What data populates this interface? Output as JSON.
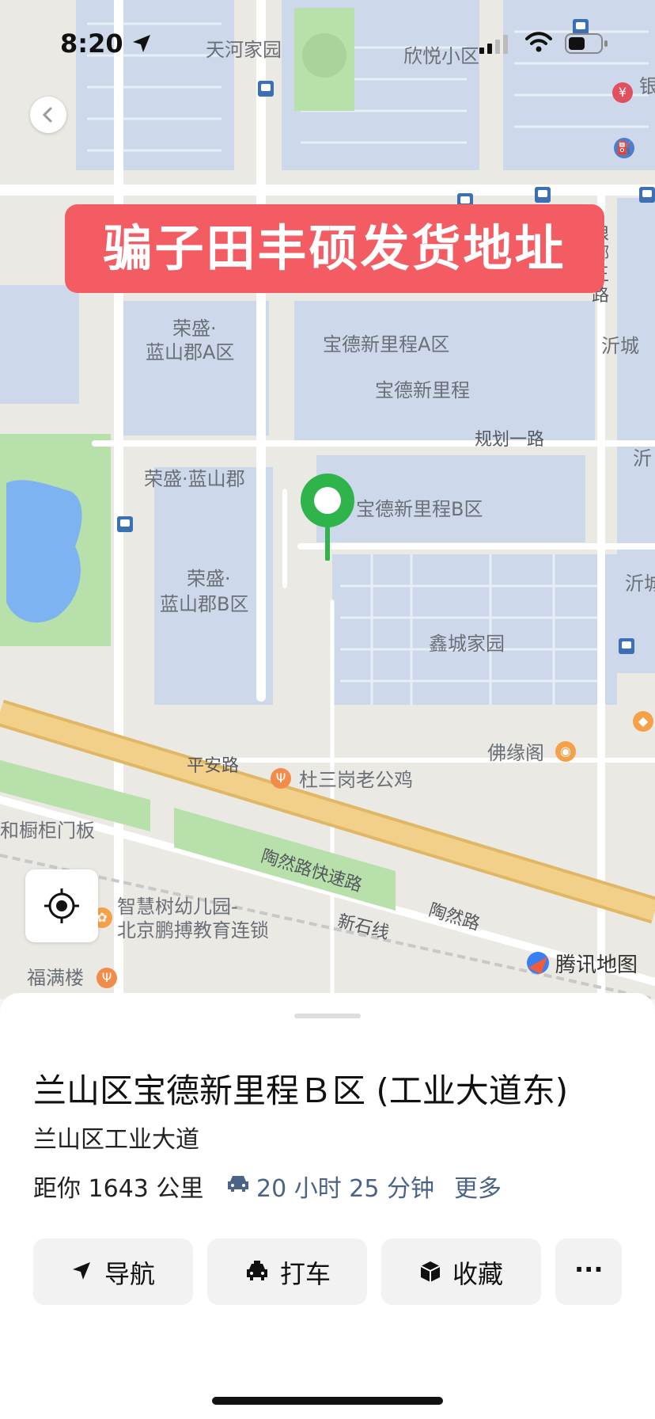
{
  "status_bar": {
    "time": "8:20"
  },
  "banner": {
    "text": "骗子田丰硕发货地址"
  },
  "map": {
    "labels": {
      "tianhe": "天河家园",
      "xinyue": "欣悦小区",
      "edge_bank": "银工",
      "rongsheng_a_1": "荣盛·",
      "rongsheng_a_2": "蓝山郡A区",
      "baode_a": "宝德新里程A区",
      "baode": "宝德新里程",
      "guihua": "规划一路",
      "rongsheng": "荣盛·蓝山郡",
      "baode_b": "宝德新里程B区",
      "rongsheng_b_1": "荣盛·",
      "rongsheng_b_2": "蓝山郡B区",
      "xincheng": "鑫城家园",
      "foyuan": "佛缘阁",
      "pingan": "平安路",
      "dusangang": "杜三岗老公鸡",
      "taoran_exp": "陶然路快速路",
      "taoran": "陶然路",
      "cabinet": "和橱柜门板",
      "kinder_1": "智慧树幼儿园-",
      "kinder_2": "北京鹏搏教育连锁",
      "xinshi": "新石线",
      "fuman": "福满楼",
      "edge_yicheng": "沂城",
      "edge_yi": "沂",
      "edge_yi2": "沂城",
      "edge_road": "琅",
      "edge_road2": "琊",
      "edge_road3": "王",
      "edge_road4": "路"
    },
    "brand": "腾讯地图"
  },
  "place": {
    "title": "兰山区宝德新里程Ｂ区 (工业大道东)",
    "address": "兰山区工业大道",
    "distance": "距你 1643 公里",
    "eta": "20 小时 25 分钟",
    "more": "更多"
  },
  "actions": {
    "navigate": "导航",
    "taxi": "打车",
    "favorite": "收藏",
    "more": "···"
  },
  "colors": {
    "banner": "#f25c62",
    "pin": "#2fb34b",
    "block": "#cdd9ea",
    "water": "#7db3f0",
    "park": "#b8e0ab",
    "expressway": "#f3d089"
  }
}
